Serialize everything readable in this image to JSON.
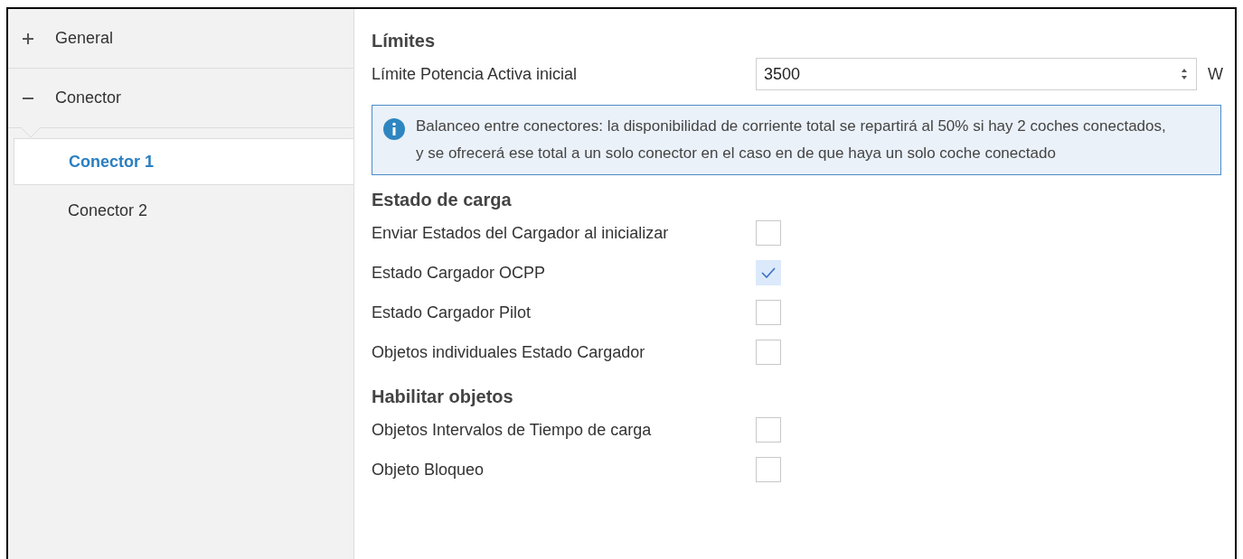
{
  "sidebar": {
    "groups": [
      {
        "label": "General",
        "expanded": false
      },
      {
        "label": "Conector",
        "expanded": true,
        "children": [
          {
            "label": "Conector 1",
            "selected": true
          },
          {
            "label": "Conector 2",
            "selected": false
          }
        ]
      }
    ]
  },
  "sections": [
    {
      "title": "Límites",
      "rows": [
        {
          "kind": "number",
          "label": "Límite Potencia Activa inicial",
          "value": "3500",
          "unit": "W"
        },
        {
          "kind": "info",
          "text": "Balanceo entre conectores: la disponibilidad de corriente total se repartirá al 50% si hay 2 coches conectados, y se ofrecerá ese total a un solo conector en el caso en de que haya un solo coche conectado"
        }
      ]
    },
    {
      "title": "Estado de carga",
      "rows": [
        {
          "kind": "checkbox",
          "label": "Enviar Estados del Cargador al inicializar",
          "checked": false
        },
        {
          "kind": "checkbox",
          "label": "Estado Cargador OCPP",
          "checked": true
        },
        {
          "kind": "checkbox",
          "label": "Estado Cargador Pilot",
          "checked": false
        },
        {
          "kind": "checkbox",
          "label": "Objetos individuales Estado Cargador",
          "checked": false
        }
      ]
    },
    {
      "title": "Habilitar objetos",
      "rows": [
        {
          "kind": "checkbox",
          "label": "Objetos Intervalos de Tiempo de carga",
          "checked": false
        },
        {
          "kind": "checkbox",
          "label": "Objeto Bloqueo",
          "checked": false
        }
      ]
    }
  ]
}
